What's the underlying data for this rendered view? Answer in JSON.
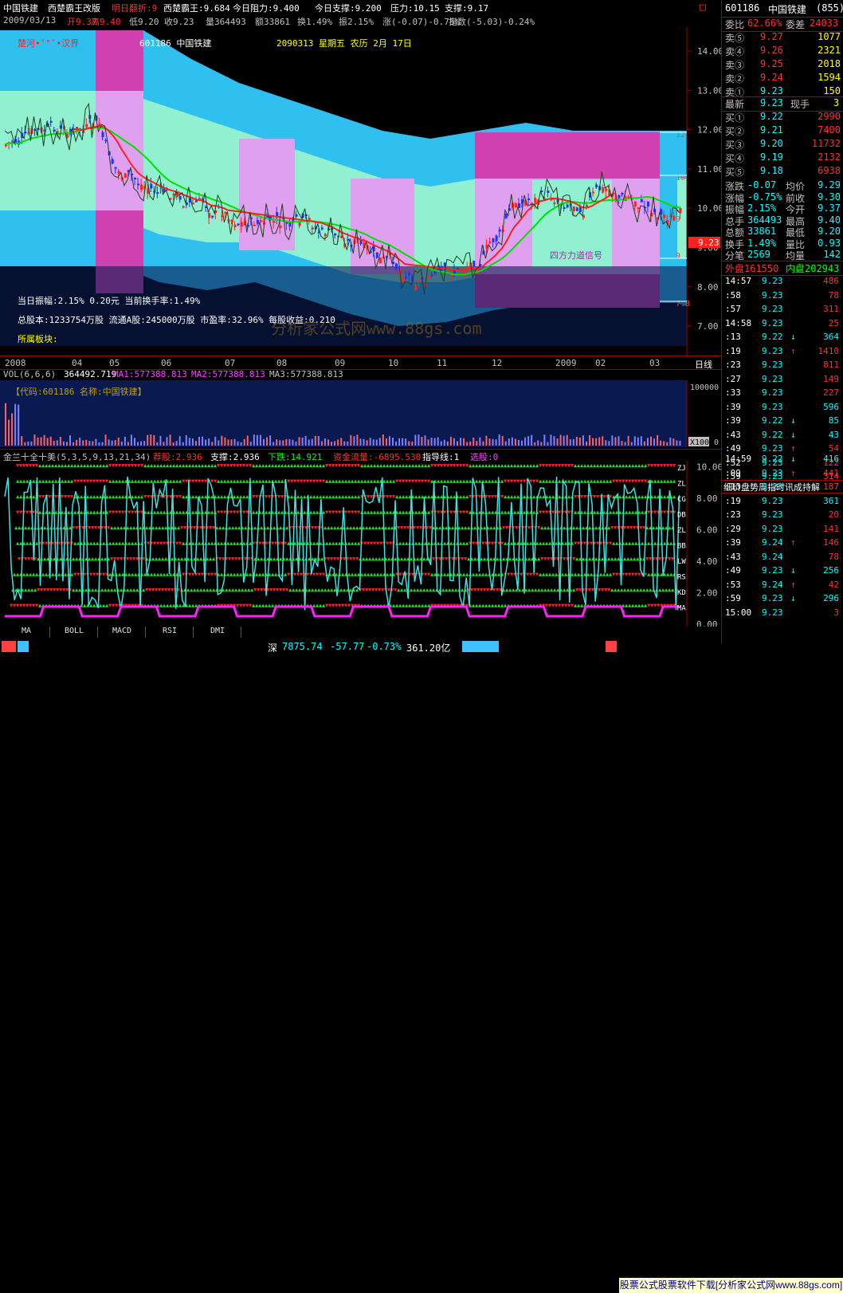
{
  "title_bar": {
    "stock_name": "中国铁建",
    "indicator_name": "西楚霸王改版",
    "next_reversal_label": "明日翻折:9",
    "xichu_label": "西楚霸王:9.684",
    "resist_label": "今日阻力:9.400",
    "support_label": "今日支撑:9.200",
    "pressure_label": "压力:10.15",
    "support2_label": "支撑:9.17",
    "window_btn": "□"
  },
  "info_bar": {
    "date": "2009/03/13",
    "open": "开9.37",
    "high": "高9.40",
    "low": "低9.20",
    "close": "收9.23",
    "volume": "量364493",
    "amount": "额33861",
    "turnover": "换1.49%",
    "amplitude": "振2.15%",
    "change": "涨(-0.07)-0.75%",
    "index": "指数(-5.03)-0.24%"
  },
  "main_chart": {
    "overlay_left": "楚河•ˇ°ˇ•汉界",
    "overlay_code": "601186  中国铁建",
    "overlay_date": "2090313  星期五  农历 2月 17日",
    "signal_label": "四方力道信号",
    "stat1": "当日振幅:2.15%    0.20元      当前换手率:1.49%",
    "stat2": "总股本:1233754万股  流通A股:245000万股  市盈率:32.96%   每股收益:0.210",
    "stat3": "所属板块:",
    "watermark": "分析家公式网www.88gs.com",
    "price_axis": [
      "14.00",
      "13.00",
      "12.00",
      "11.00",
      "10.00",
      "9.00",
      "8.00",
      "7.00"
    ],
    "right_marks": [
      "12",
      "10",
      "9",
      "9",
      "7.8"
    ],
    "current_price_tag": "9.23",
    "x_labels": [
      "2008",
      "04",
      "05",
      "06",
      "07",
      "08",
      "09",
      "10",
      "11",
      "12",
      "2009",
      "02",
      "03"
    ],
    "period_btn": "日线"
  },
  "volume_panel": {
    "header_vol": "VOL(6,6,6)",
    "vol_value": "364492.719",
    "ma1": "MA1:577388.813",
    "ma2": "MA2:577388.813",
    "ma3": "MA3:577388.813",
    "code_label": "【代码:601186 名称:中国铁建】",
    "axis_top": "100000",
    "axis_unit": "X100",
    "axis_zero": "0"
  },
  "indicator_panel": {
    "name": "金兰十全十美(5,3,5,9,13,21,34)",
    "buy": "荐股:2.936",
    "support": "支撑:2.936",
    "drop": "下跌:14.921",
    "fund": "资金流量:-6895.530",
    "guide": "指导线:1",
    "pick": "选股:0",
    "axis": [
      "10.00",
      "8.00",
      "6.00",
      "4.00",
      "2.00",
      "0.00"
    ],
    "row_labels": [
      "ZJ",
      "ZL",
      "CG",
      "DB",
      "ZL",
      "BB",
      "LW",
      "RS",
      "KD",
      "MA"
    ]
  },
  "right_panel": {
    "code": "601186",
    "name": "中国铁建",
    "code_suffix": "(855)",
    "weibi": "委比",
    "weibi_val": "62.66%",
    "weicha": "委差",
    "weicha_val": "24033",
    "sell": [
      {
        "label": "卖⑤",
        "price": "9.27",
        "vol": "1077"
      },
      {
        "label": "卖④",
        "price": "9.26",
        "vol": "2321"
      },
      {
        "label": "卖③",
        "price": "9.25",
        "vol": "2018"
      },
      {
        "label": "卖②",
        "price": "9.24",
        "vol": "1594"
      },
      {
        "label": "卖①",
        "price": "9.23",
        "vol": "150"
      }
    ],
    "latest_label": "最新",
    "latest_price": "9.23",
    "now_vol_label": "现手",
    "now_vol": "3",
    "buy": [
      {
        "label": "买①",
        "price": "9.22",
        "vol": "2990"
      },
      {
        "label": "买②",
        "price": "9.21",
        "vol": "7400"
      },
      {
        "label": "买③",
        "price": "9.20",
        "vol": "11732"
      },
      {
        "label": "买④",
        "price": "9.19",
        "vol": "2132"
      },
      {
        "label": "买⑤",
        "price": "9.18",
        "vol": "6938"
      }
    ],
    "stats": [
      {
        "l1": "涨跌",
        "v1": "-0.07",
        "l2": "均价",
        "v2": "9.29"
      },
      {
        "l1": "涨幅",
        "v1": "-0.75%",
        "l2": "前收",
        "v2": "9.30"
      },
      {
        "l1": "振幅",
        "v1": "2.15%",
        "l2": "今开",
        "v2": "9.37"
      },
      {
        "l1": "总手",
        "v1": "364493",
        "l2": "最高",
        "v2": "9.40"
      },
      {
        "l1": "总额",
        "v1": "33861",
        "l2": "最低",
        "v2": "9.20"
      },
      {
        "l1": "换手",
        "v1": "1.49%",
        "l2": "量比",
        "v2": "0.93"
      },
      {
        "l1": "分笔",
        "v1": "2569",
        "l2": "均量",
        "v2": "142"
      }
    ],
    "waipan": "外盘161550",
    "neipan": "内盘202943",
    "ticks1": [
      {
        "t": "14:57",
        "p": "9.23",
        "a": "",
        "v": "486",
        "c": "red"
      },
      {
        "t": ":58",
        "p": "9.23",
        "a": "",
        "v": "78",
        "c": "red"
      },
      {
        "t": ":57",
        "p": "9.23",
        "a": "",
        "v": "311",
        "c": "red"
      },
      {
        "t": "14:58",
        "p": "9.23",
        "a": "",
        "v": "25",
        "c": "red"
      },
      {
        "t": ":13",
        "p": "9.22",
        "a": "↓",
        "v": "364",
        "c": "cyn"
      },
      {
        "t": ":19",
        "p": "9.23",
        "a": "↑",
        "v": "1410",
        "c": "red"
      },
      {
        "t": ":23",
        "p": "9.23",
        "a": "",
        "v": "811",
        "c": "red"
      },
      {
        "t": ":27",
        "p": "9.23",
        "a": "",
        "v": "149",
        "c": "red"
      },
      {
        "t": ":33",
        "p": "9.23",
        "a": "",
        "v": "227",
        "c": "red"
      },
      {
        "t": ":39",
        "p": "9.23",
        "a": "",
        "v": "596",
        "c": "cyn"
      },
      {
        "t": ":39",
        "p": "9.22",
        "a": "↓",
        "v": "85",
        "c": "cyn"
      },
      {
        "t": ":43",
        "p": "9.22",
        "a": "↓",
        "v": "43",
        "c": "cyn"
      },
      {
        "t": ":49",
        "p": "9.23",
        "a": "↑",
        "v": "54",
        "c": "red"
      },
      {
        "t": ":52",
        "p": "9.23",
        "a": "",
        "v": "122",
        "c": "red"
      },
      {
        "t": ":59",
        "p": "9.23",
        "a": "",
        "v": "314",
        "c": "red"
      }
    ],
    "tab_label": "细价盘势周指时讯成持解",
    "ticks2": [
      {
        "t": "14:59",
        "p": "9.22",
        "a": "↓",
        "v": "416",
        "c": "cyn"
      },
      {
        "t": ":09",
        "p": "9.23",
        "a": "↑",
        "v": "441",
        "c": "red"
      },
      {
        "t": ":13",
        "p": "9.23",
        "a": "",
        "v": "187",
        "c": "red"
      },
      {
        "t": ":19",
        "p": "9.23",
        "a": "",
        "v": "361",
        "c": "cyn"
      },
      {
        "t": ":23",
        "p": "9.23",
        "a": "",
        "v": "20",
        "c": "red"
      },
      {
        "t": ":29",
        "p": "9.23",
        "a": "",
        "v": "141",
        "c": "red"
      },
      {
        "t": ":39",
        "p": "9.24",
        "a": "↑",
        "v": "146",
        "c": "red"
      },
      {
        "t": ":43",
        "p": "9.24",
        "a": "",
        "v": "78",
        "c": "red"
      },
      {
        "t": ":49",
        "p": "9.23",
        "a": "↓",
        "v": "256",
        "c": "cyn"
      },
      {
        "t": ":53",
        "p": "9.24",
        "a": "↑",
        "v": "42",
        "c": "red"
      },
      {
        "t": ":59",
        "p": "9.23",
        "a": "↓",
        "v": "296",
        "c": "cyn"
      },
      {
        "t": "15:00",
        "p": "9.23",
        "a": "",
        "v": "3",
        "c": "red"
      }
    ]
  },
  "bottom_tabs": [
    "MA",
    "BOLL",
    "MACD",
    "RSI",
    "DMI"
  ],
  "status_bar": {
    "index_label": "深",
    "index_value": "7875.74",
    "index_change": "-57.77",
    "index_pct": "-0.73%",
    "index_amount": "361.20亿",
    "ad_text": "股票公式股票软件下载[分析家公式网www.88gs.com]"
  },
  "colors": {
    "bg": "#000000",
    "up": "#ff3030",
    "down": "#3040ff",
    "band_cyan": "#30c0f0",
    "band_pink": "#d040b0",
    "band_light_pink": "#e0a0f0",
    "band_light_green": "#90f0d0",
    "chart_navy": "#0a1a50"
  }
}
